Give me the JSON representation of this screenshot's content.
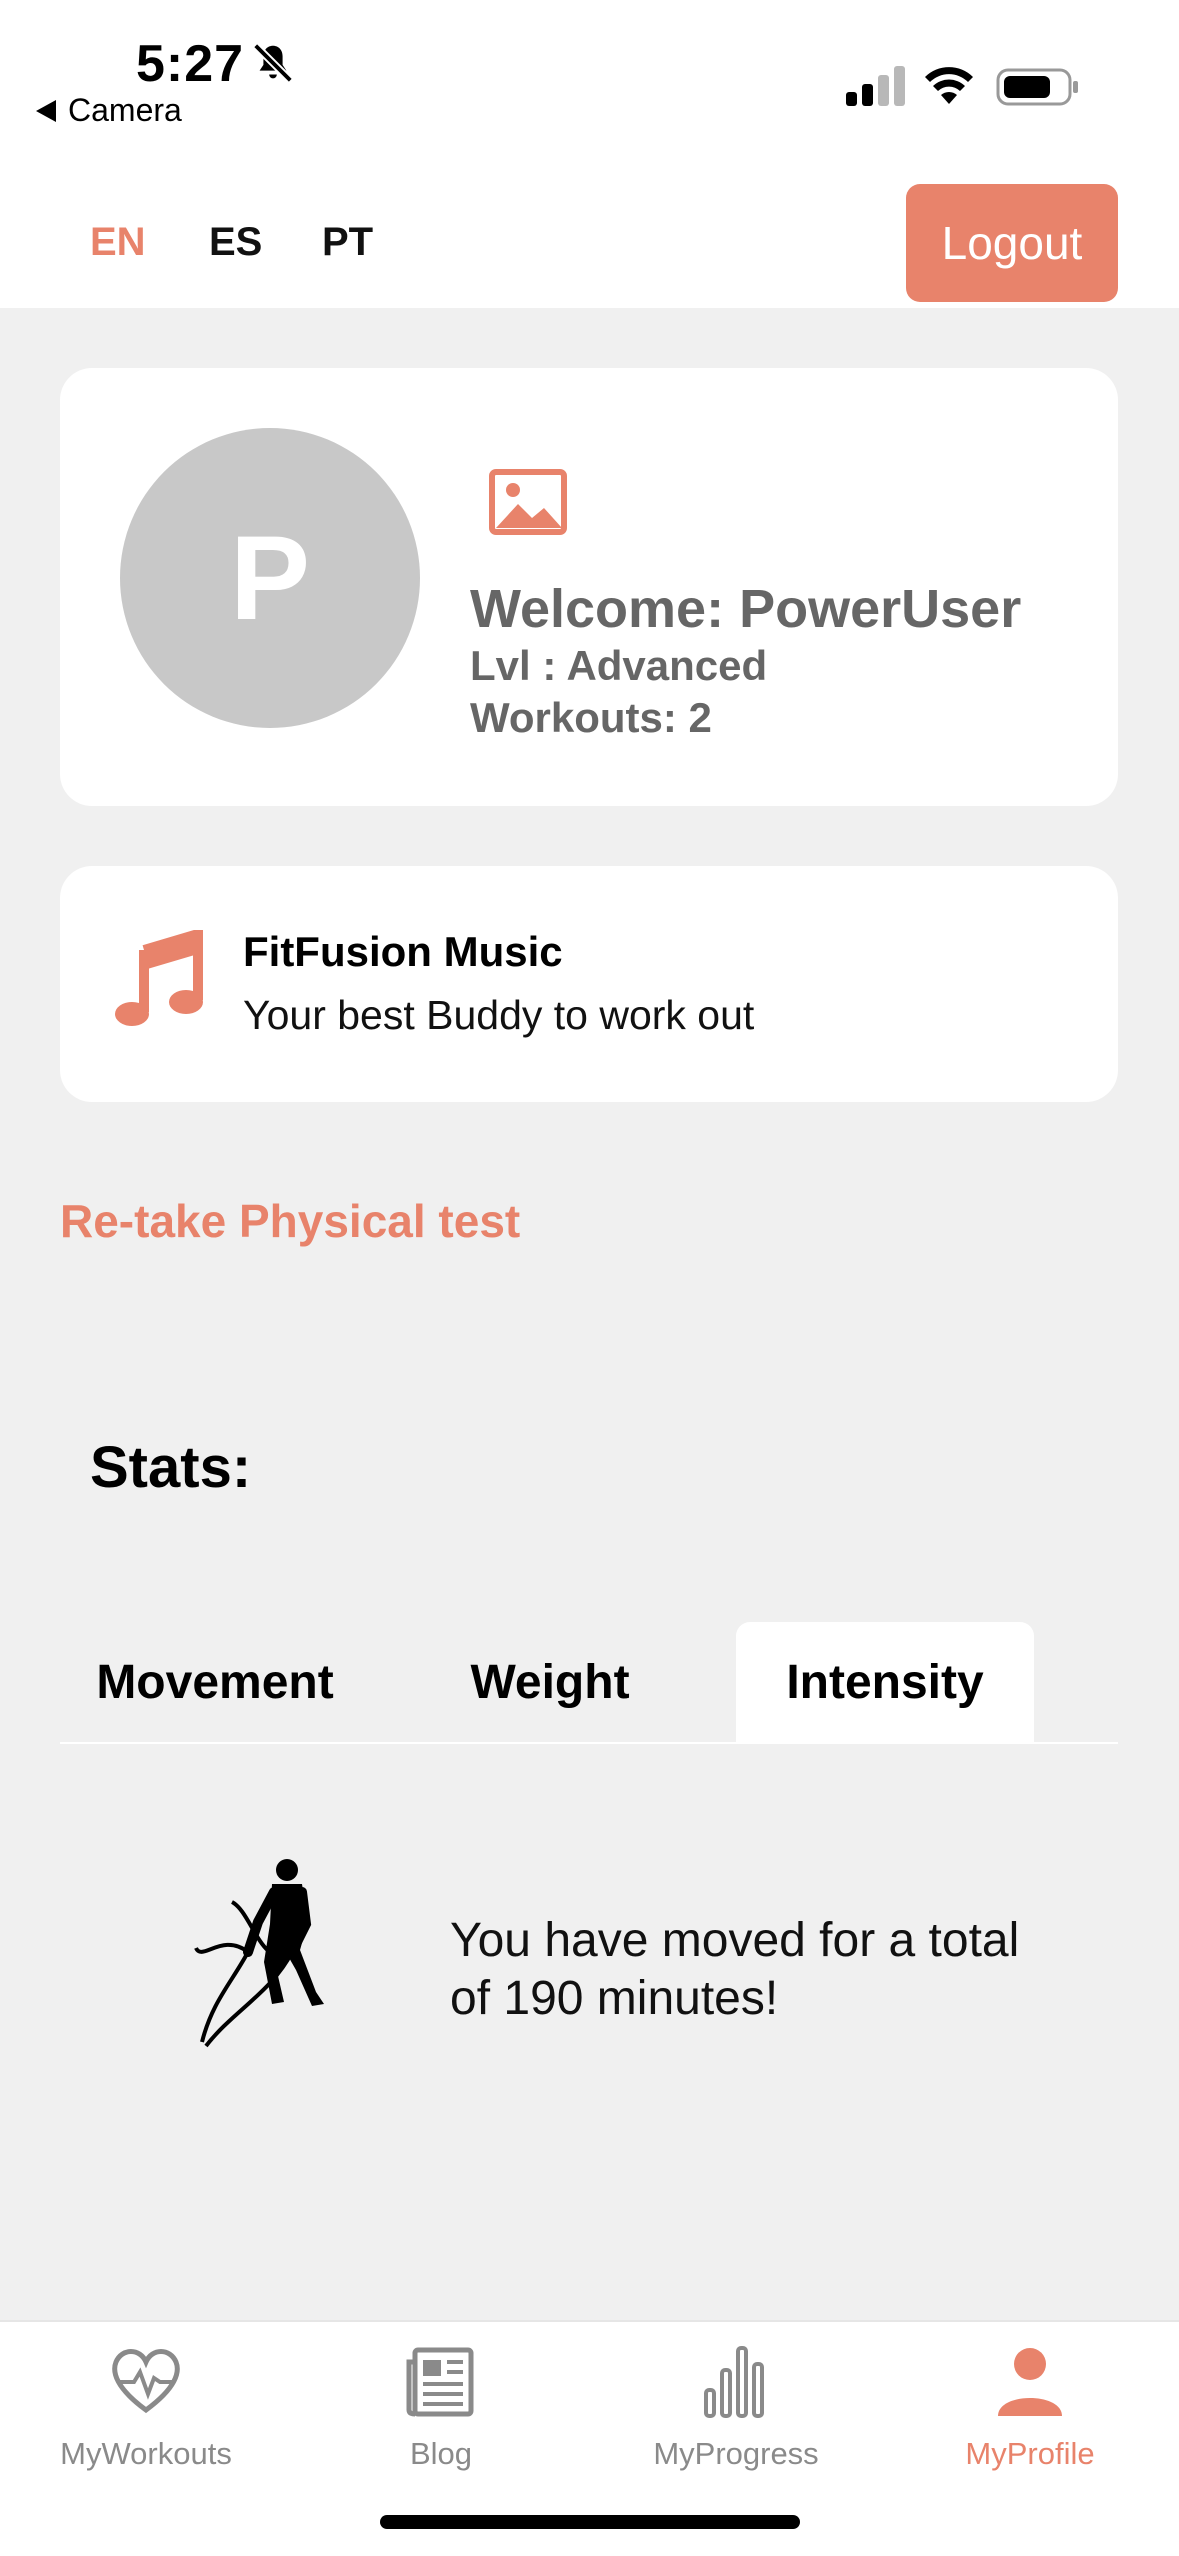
{
  "status": {
    "time": "5:27",
    "back_label": "Camera"
  },
  "languages": [
    {
      "code": "EN",
      "active": true
    },
    {
      "code": "ES",
      "active": false
    },
    {
      "code": "PT",
      "active": false
    }
  ],
  "logout_label": "Logout",
  "profile": {
    "avatar_letter": "P",
    "welcome": "Welcome: PowerUser",
    "level": "Lvl : Advanced",
    "workouts": "Workouts: 2"
  },
  "music": {
    "title": "FitFusion Music",
    "subtitle": "Your best Buddy to work out"
  },
  "retake_label": "Re-take Physical test",
  "stats_title": "Stats:",
  "tabs": [
    {
      "label": "Movement",
      "active": false
    },
    {
      "label": "Weight",
      "active": false
    },
    {
      "label": "Intensity",
      "active": true
    }
  ],
  "stat_message": "You have moved for a total of 190 minutes!",
  "nav": [
    {
      "label": "MyWorkouts",
      "icon": "heart-pulse-icon",
      "active": false
    },
    {
      "label": "Blog",
      "icon": "newspaper-icon",
      "active": false
    },
    {
      "label": "MyProgress",
      "icon": "bar-chart-icon",
      "active": false
    },
    {
      "label": "MyProfile",
      "icon": "person-icon",
      "active": true
    }
  ],
  "colors": {
    "accent": "#e8836b",
    "background": "#f0f0f0",
    "card": "#ffffff",
    "muted": "#666666"
  }
}
